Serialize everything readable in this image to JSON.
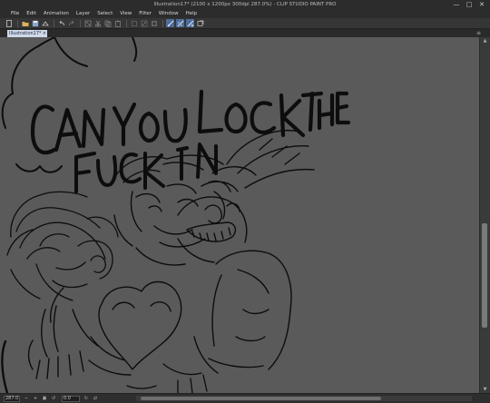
{
  "window": {
    "title": "Illustration17* (2100 x 1200px 300dpi 287.0%)  - CLIP STUDIO PAINT PRO",
    "minimize": "—",
    "maximize": "□",
    "close": "✕"
  },
  "menu": [
    "File",
    "Edit",
    "Animation",
    "Layer",
    "Select",
    "View",
    "Filter",
    "Window",
    "Help"
  ],
  "toolbar": {
    "icons": [
      "new-file-icon",
      "open-icon",
      "save-icon",
      "export-icon",
      "undo-icon",
      "redo-icon",
      "clear-icon",
      "cut-icon",
      "copy-icon",
      "paste-icon",
      "transform-icon",
      "deselect-icon",
      "invert-selection-icon",
      "snap-ruler-icon",
      "snap-grid-icon",
      "snap-special-icon",
      "refresh-icon"
    ],
    "active": [
      "snap-ruler-icon",
      "snap-grid-icon",
      "snap-special-icon"
    ]
  },
  "document_tab": {
    "label": "Illustration17*",
    "close": "×"
  },
  "canvas": {
    "background": "#5a5a5a",
    "ink": "#0d0d0d",
    "handwritten_text_line1": "CAN YOU LOCK THE",
    "handwritten_text_line2": "FUCK IN"
  },
  "statusbar": {
    "zoom_value": "287.0",
    "angle_value": "0.0"
  },
  "colors": {
    "chrome": "#2c2c2c",
    "toolbar": "#363636",
    "tab_active": "#cfd8e8",
    "accent": "#4d6d9a"
  }
}
